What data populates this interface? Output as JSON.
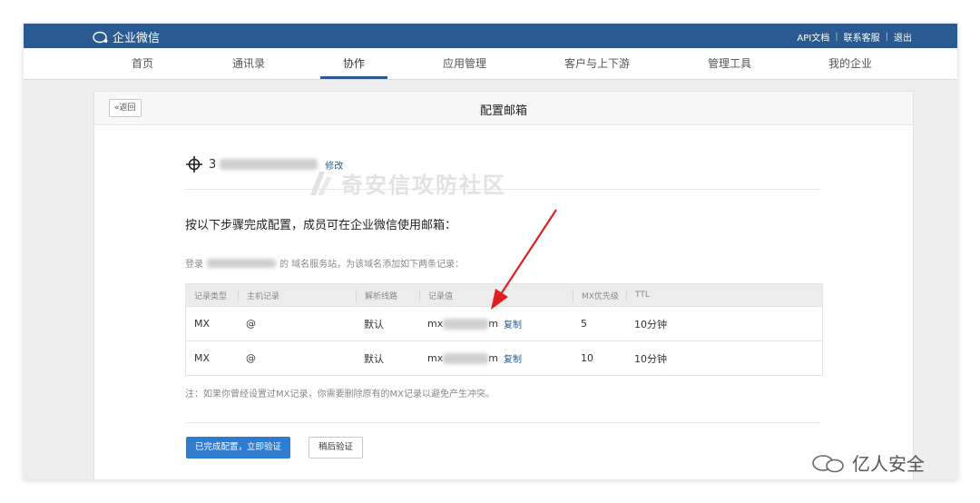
{
  "topbar": {
    "logo_text": "企业微信",
    "links": [
      "API文档",
      "联系客服",
      "退出"
    ]
  },
  "nav": {
    "items": [
      "首页",
      "通讯录",
      "协作",
      "应用管理",
      "客户与上下游",
      "管理工具",
      "我的企业"
    ],
    "active": "协作"
  },
  "panel": {
    "back_label": "«返回",
    "title": "配置邮箱",
    "domain_prefix": "3",
    "edit_label": "修改",
    "instruction": "按以下步骤完成配置，成员可在企业微信使用邮箱：",
    "login_prefix": "登录",
    "login_suffix": "的 域名服务站，为该域名添加如下两条记录：",
    "table": {
      "headers": [
        "记录类型",
        "主机记录",
        "解析线路",
        "记录值",
        "MX优先级",
        "TTL"
      ],
      "rows": [
        {
          "type": "MX",
          "host": "@",
          "line": "默认",
          "value_start": "mx",
          "value_end": "m",
          "copy": "复制",
          "priority": "5",
          "ttl": "10分钟"
        },
        {
          "type": "MX",
          "host": "@",
          "line": "默认",
          "value_start": "mx",
          "value_end": "m",
          "copy": "复制",
          "priority": "10",
          "ttl": "10分钟"
        }
      ]
    },
    "note": "注：如果你曾经设置过MX记录，你需要删除原有的MX记录以避免产生冲突。",
    "primary_button": "已完成配置，立即验证",
    "secondary_button": "稍后验证"
  },
  "watermark": "奇安信攻防社区",
  "wechat_mark": "亿人安全",
  "colors": {
    "brand": "#2a5a8f",
    "primary_button": "#2f7bd0",
    "arrow": "#e02020"
  }
}
